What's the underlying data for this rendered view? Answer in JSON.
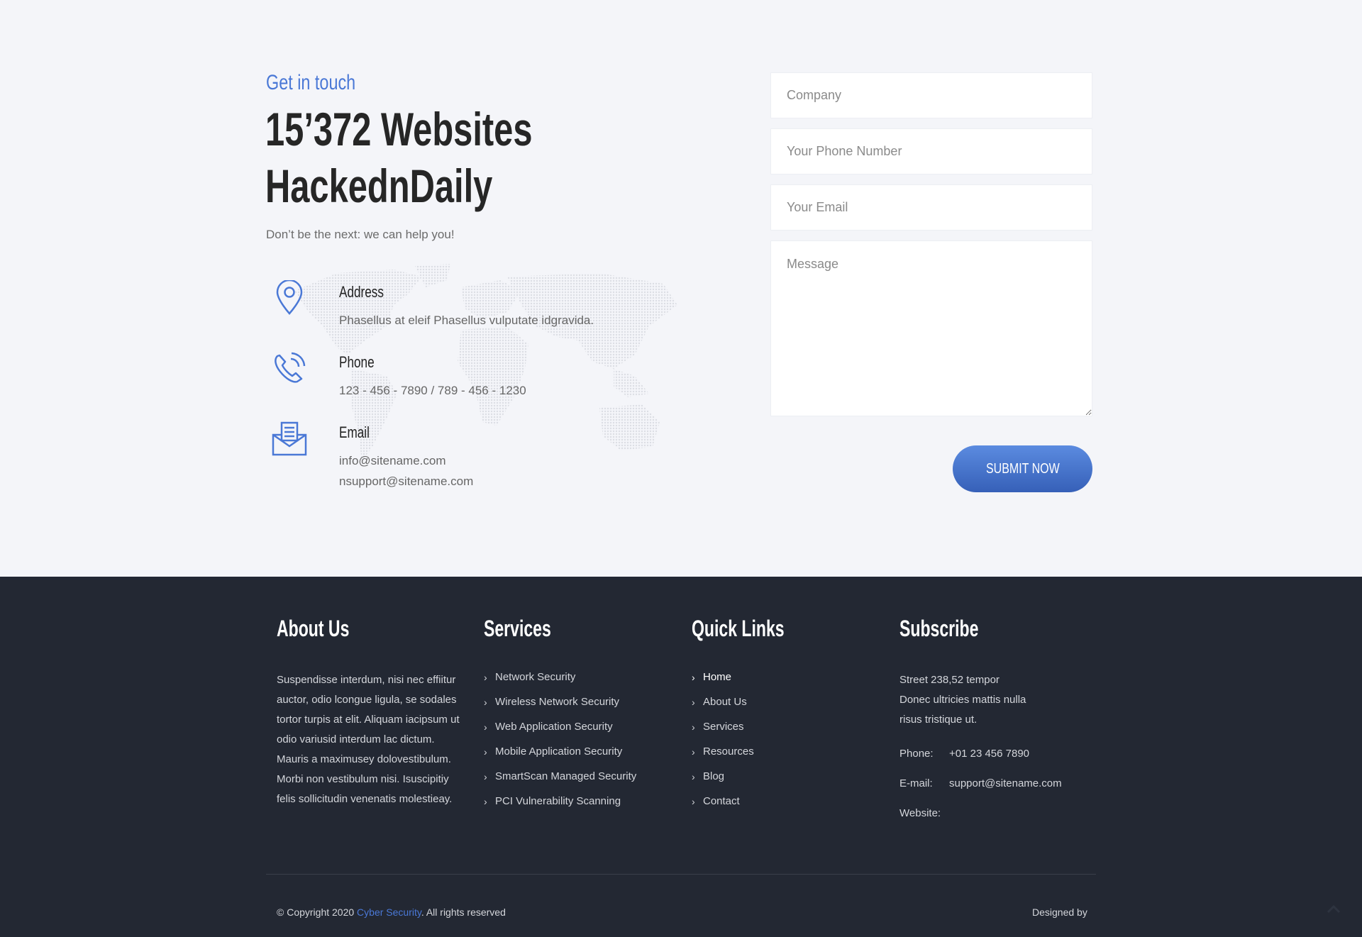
{
  "contact": {
    "eyebrow": "Get in touch",
    "headline_line1": "15’372 Websites",
    "headline_line2": "HackednDaily",
    "tagline": "Don’t be the next: we can help you!",
    "items": [
      {
        "icon": "map-pin-icon",
        "title": "Address",
        "lines": [
          "Phasellus at eleif Phasellus vulputate idgravida."
        ]
      },
      {
        "icon": "phone-icon",
        "title": "Phone",
        "lines": [
          "123 - 456 - 7890 / 789 - 456 - 1230"
        ]
      },
      {
        "icon": "envelope-icon",
        "title": "Email",
        "lines": [
          "info@sitename.com",
          "nsupport@sitename.com"
        ]
      }
    ],
    "accent_color": "#4a78d6"
  },
  "form": {
    "company_placeholder": "Company",
    "company_value": "",
    "phone_placeholder": "Your Phone Number",
    "phone_value": "",
    "email_placeholder": "Your Email",
    "email_value": "",
    "message_placeholder": "Message",
    "message_value": "",
    "submit_label": "SUBMIT NOW"
  },
  "footer": {
    "about": {
      "heading": "About Us",
      "text": "Suspendisse interdum, nisi nec effiitur auctor, odio lcongue ligula, se sodales tortor turpis at elit. Aliquam iacipsum ut odio variusid interdum lac dictum. Mauris a maximusey dolovestibulum. Morbi non vestibulum nisi. Isuscipitiy felis sollicitudin venenatis molestieay."
    },
    "services": {
      "heading": "Services",
      "items": [
        "Network Security",
        "Wireless Network Security",
        "Web Application Security",
        "Mobile Application Security",
        "SmartScan Managed Security",
        "PCI Vulnerability Scanning"
      ]
    },
    "quick_links": {
      "heading": "Quick Links",
      "items": [
        "Home",
        "About Us",
        "Services",
        "Resources",
        "Blog",
        "Contact"
      ],
      "active": "Home"
    },
    "subscribe": {
      "heading": "Subscribe",
      "address_lines": [
        "Street 238,52 tempor",
        "Donec ultricies mattis nulla",
        "risus tristique ut."
      ],
      "phone_label": "Phone:",
      "phone_value": "+01 23 456 7890",
      "email_label": "E-mail:",
      "email_value": "support@sitename.com",
      "website_label": "Website:",
      "website_value": ""
    },
    "copyright_prefix": "© Copyright 2020 ",
    "copyright_link": "Cyber Security",
    "copyright_suffix": ". All rights reserved",
    "designed_by": "Designed by",
    "background_color": "#232833"
  }
}
